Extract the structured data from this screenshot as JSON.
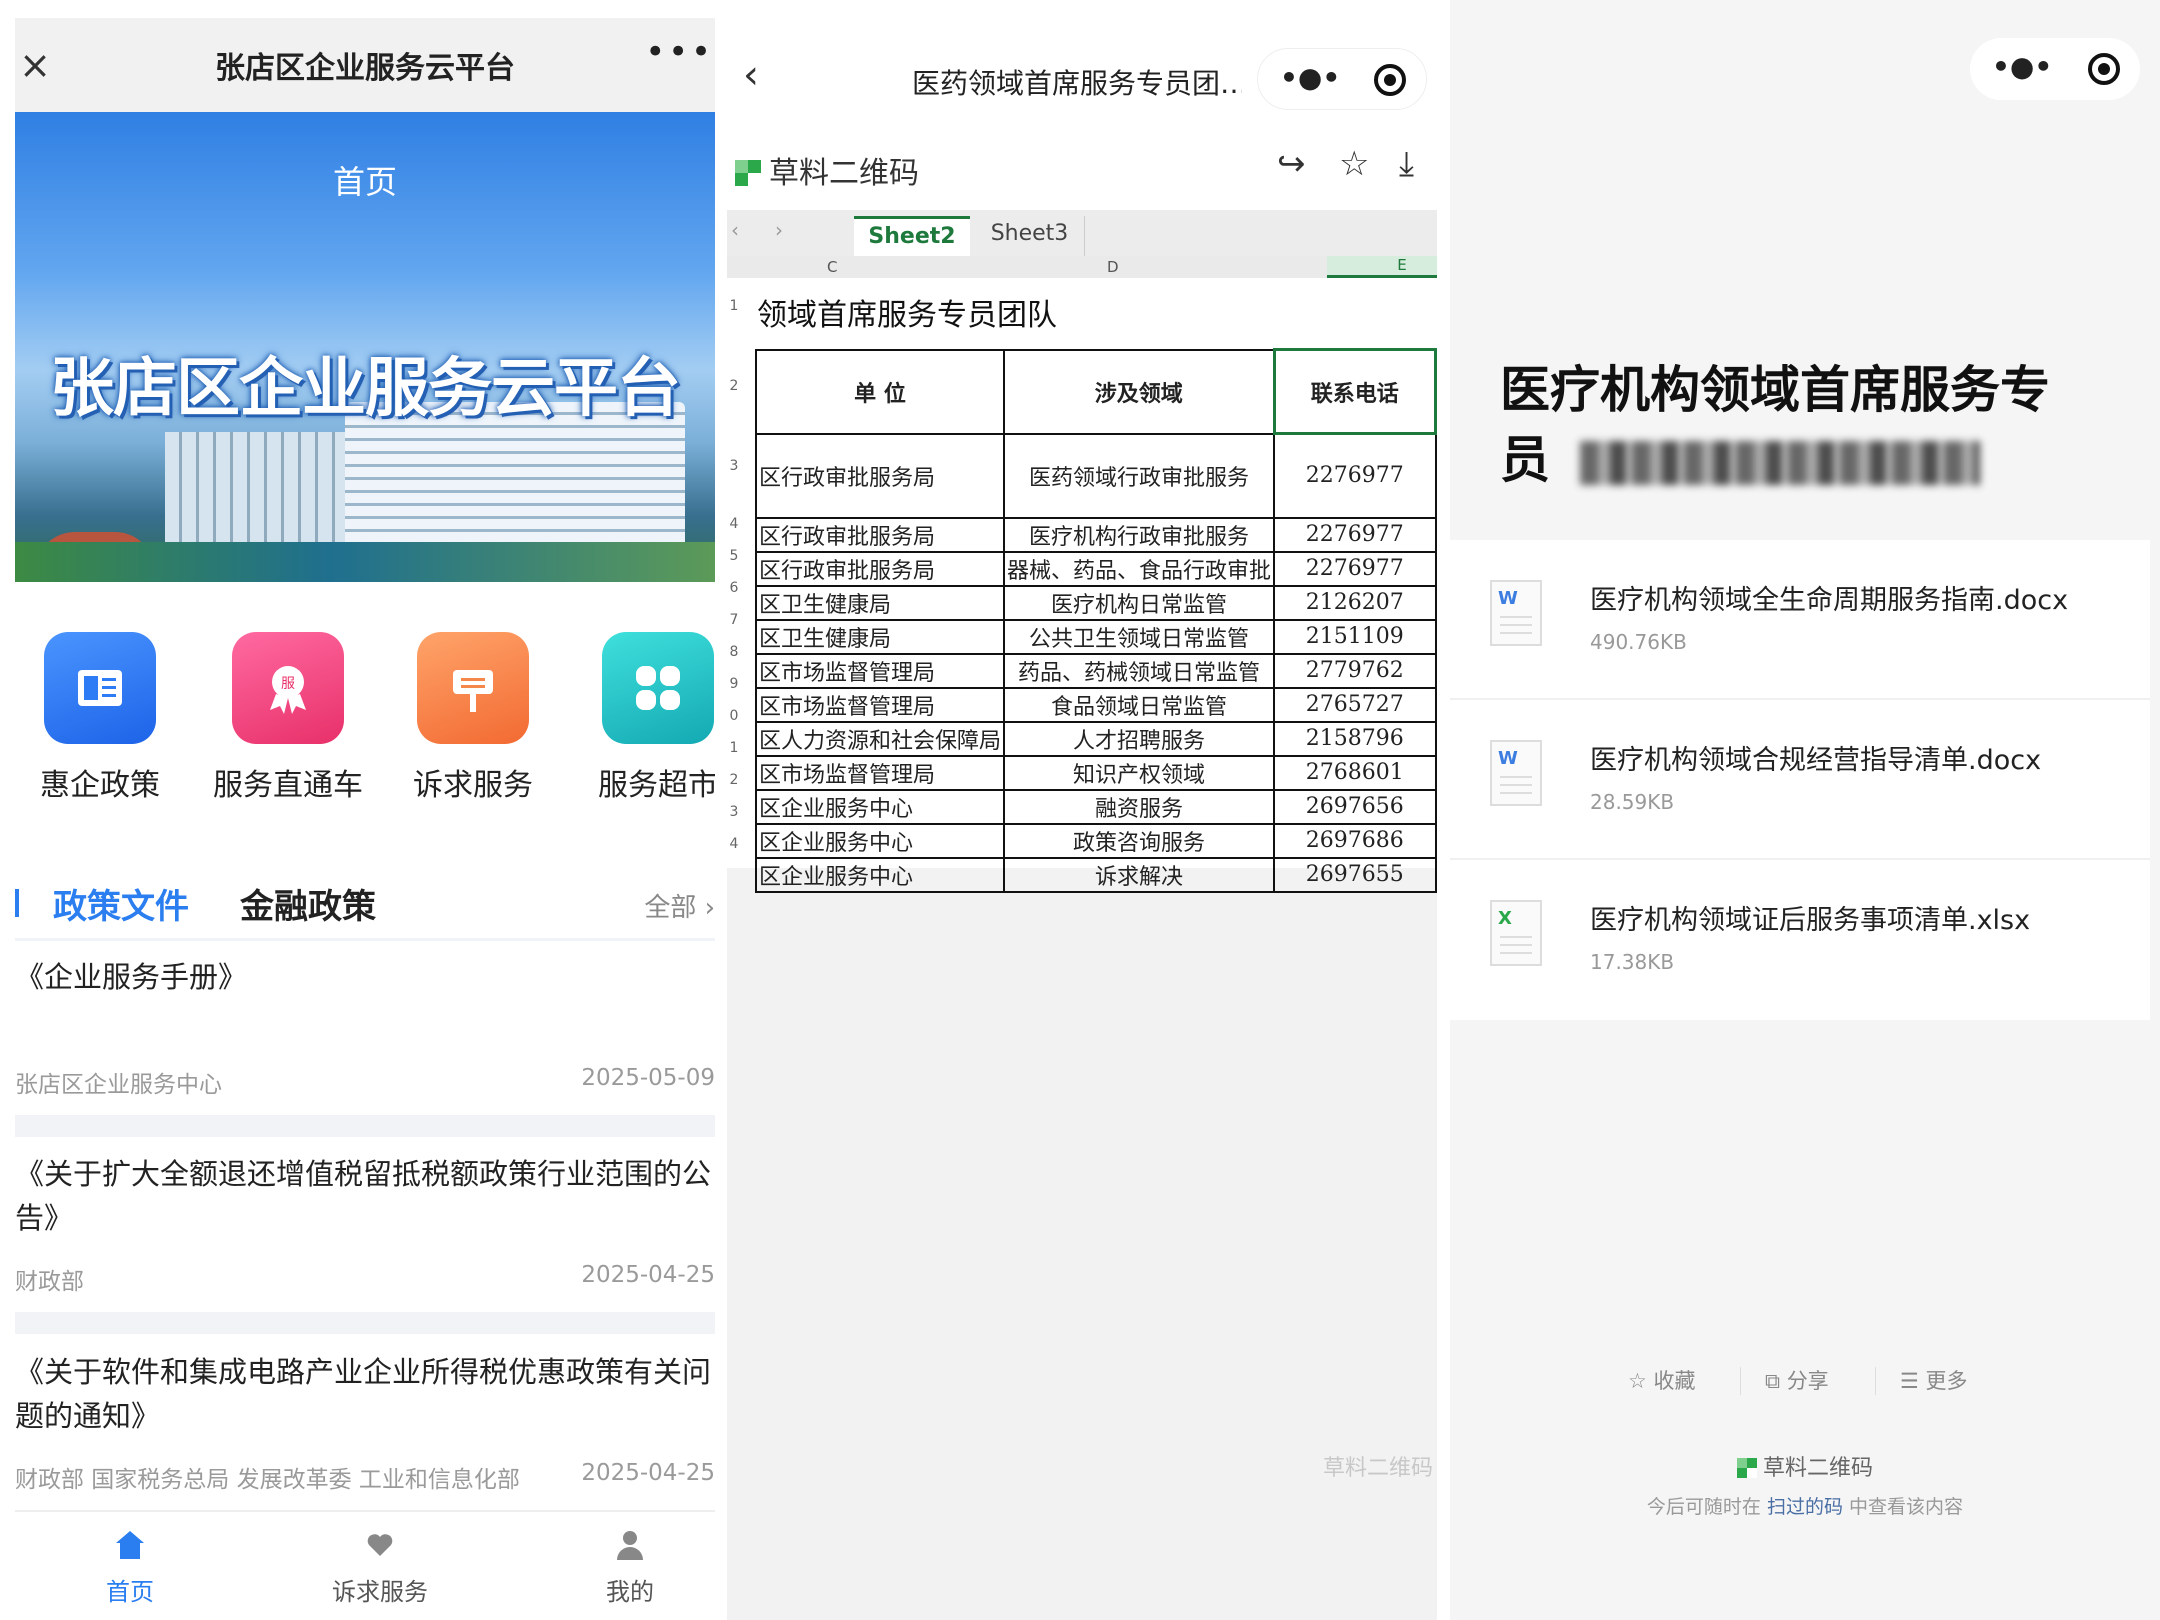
{
  "panel1": {
    "title": "张店区企业服务云平台",
    "banner_tab": "首页",
    "banner_title": "张店区企业服务云平台",
    "icons": [
      {
        "label": "惠企政策",
        "icon": "policy-book-icon",
        "color": "#2d7cf6"
      },
      {
        "label": "服务直通车",
        "icon": "service-badge-icon",
        "color": "#f0457a"
      },
      {
        "label": "诉求服务",
        "icon": "signboard-icon",
        "color": "#f6874a"
      },
      {
        "label": "服务超市",
        "icon": "grid-apps-icon",
        "color": "#22c3c6"
      }
    ],
    "tabs": {
      "active": "政策文件",
      "other": "金融政策",
      "all": "全部"
    },
    "articles": [
      {
        "title": "《企业服务手册》",
        "source": "张店区企业服务中心",
        "date": "2025-05-09"
      },
      {
        "title": "《关于扩大全额退还增值税留抵税额政策行业范围的公告》",
        "source": "财政部",
        "date": "2025-04-25"
      },
      {
        "title": "《关于软件和集成电路产业企业所得税优惠政策有关问题的通知》",
        "source": "财政部 国家税务总局 发展改革委 工业和信息化部",
        "date": "2025-04-25"
      }
    ],
    "nav": [
      {
        "label": "首页",
        "icon": "home-icon",
        "active": true
      },
      {
        "label": "诉求服务",
        "icon": "heart-hand-icon",
        "active": false
      },
      {
        "label": "我的",
        "icon": "user-icon",
        "active": false
      }
    ]
  },
  "panel2": {
    "title": "医药领域首席服务专员团…",
    "brand": "草料二维码",
    "sheets": [
      "Sheet2",
      "Sheet3"
    ],
    "active_sheet": "Sheet2",
    "columns": [
      "C",
      "D",
      "E"
    ],
    "sheet_title": "领域首席服务专员团队",
    "headers": [
      "单 位",
      "涉及领域",
      "联系电话"
    ],
    "rows": [
      [
        "区行政审批服务局",
        "医药领域行政审批服务",
        "2276977"
      ],
      [
        "区行政审批服务局",
        "医疗机构行政审批服务",
        "2276977"
      ],
      [
        "区行政审批服务局",
        "器械、药品、食品行政审批",
        "2276977"
      ],
      [
        "区卫生健康局",
        "医疗机构日常监管",
        "2126207"
      ],
      [
        "区卫生健康局",
        "公共卫生领域日常监管",
        "2151109"
      ],
      [
        "区市场监督管理局",
        "药品、药械领域日常监管",
        "2779762"
      ],
      [
        "区市场监督管理局",
        "食品领域日常监管",
        "2765727"
      ],
      [
        "区人力资源和社会保障局",
        "人才招聘服务",
        "2158796"
      ],
      [
        "区市场监督管理局",
        "知识产权领域",
        "2768601"
      ],
      [
        "区企业服务中心",
        "融资服务",
        "2697656"
      ],
      [
        "区企业服务中心",
        "政策咨询服务",
        "2697686"
      ],
      [
        "区企业服务中心",
        "诉求解决",
        "2697655"
      ]
    ],
    "row_numbers": [
      "1",
      "2",
      "3",
      "4",
      "5",
      "6",
      "7",
      "8",
      "9",
      "0",
      "1",
      "2",
      "3",
      "4"
    ],
    "watermark": "草料二维码"
  },
  "panel3": {
    "title_line1": "医疗机构领域首席服务专",
    "title_line2": "员",
    "files": [
      {
        "name": "医疗机构领域全生命周期服务指南.docx",
        "size": "490.76KB",
        "type": "W",
        "color": "#3b7de0"
      },
      {
        "name": "医疗机构领域合规经营指导清单.docx",
        "size": "28.59KB",
        "type": "W",
        "color": "#3b7de0"
      },
      {
        "name": "医疗机构领域证后服务事项清单.xlsx",
        "size": "17.38KB",
        "type": "X",
        "color": "#2aa84a"
      }
    ],
    "actions": [
      "收藏",
      "分享",
      "更多"
    ],
    "footer_brand": "草料二维码",
    "footer_pre": "今后可随时在",
    "footer_link": "扫过的码",
    "footer_post": "中查看该内容"
  }
}
